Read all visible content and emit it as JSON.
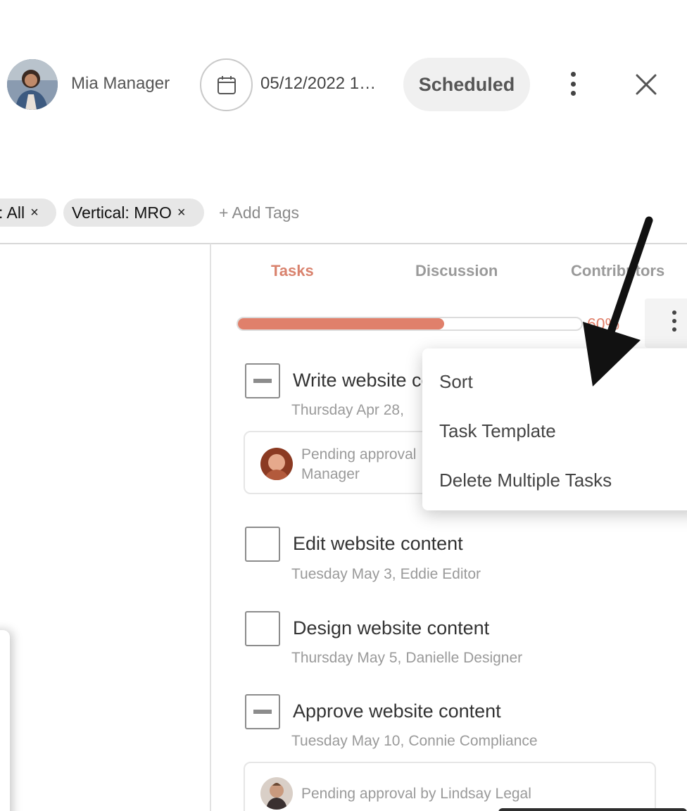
{
  "header": {
    "owner_name": "Mia Manager",
    "date": "05/12/2022 1…",
    "status": "Scheduled"
  },
  "tags": {
    "items": [
      {
        "label": ": All",
        "remove": "×"
      },
      {
        "label": "Vertical: MRO",
        "remove": "×"
      }
    ],
    "add_label": "+ Add Tags"
  },
  "tabs": {
    "tasks": "Tasks",
    "discussion": "Discussion",
    "contributors": "Contributors"
  },
  "progress": {
    "fraction": 0.6,
    "label": "60%"
  },
  "tasks": [
    {
      "title": "Write website content",
      "date": "Thursday Apr 28,",
      "assignee": "",
      "state": "partial",
      "approval": "Pending approval by Mia Manager"
    },
    {
      "title": "Edit website content",
      "date": "Tuesday May 3,",
      "assignee": "Eddie Editor",
      "state": "empty"
    },
    {
      "title": "Design website content",
      "date": "Thursday May 5,",
      "assignee": "Danielle Designer",
      "state": "empty"
    },
    {
      "title": "Approve website content",
      "date": "Tuesday May 10,",
      "assignee": "Connie Compliance",
      "state": "partial",
      "approval": "Pending approval by Lindsay Legal"
    }
  ],
  "approval_first": {
    "line1": "Pending approval",
    "line2": "Manager"
  },
  "menu": {
    "items": [
      "Sort",
      "Task Template",
      "Delete Multiple Tasks"
    ]
  },
  "colors": {
    "accent": "#e0806b",
    "tab_active": "#d9826d",
    "muted": "#9a9a9a"
  }
}
